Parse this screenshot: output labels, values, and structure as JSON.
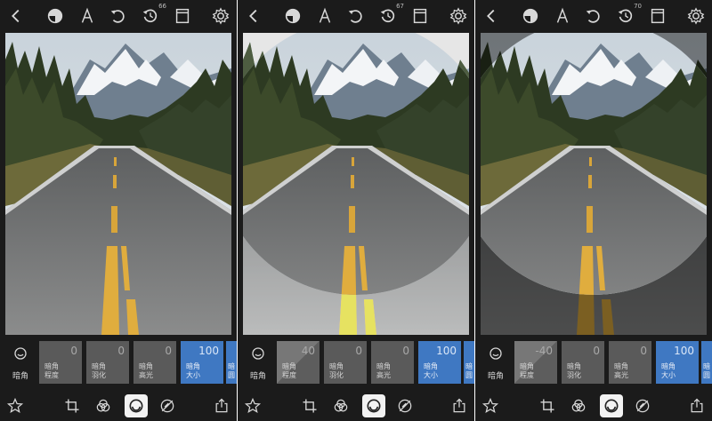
{
  "colors": {
    "panel_bg": "#1b1b1b",
    "tile_gray": "#5a5a5a",
    "tile_blue": "#3f78c2",
    "icon": "#d8d8d8"
  },
  "toolbar_icons": [
    "back-icon",
    "mask-icon",
    "text-icon",
    "undo-icon",
    "history-icon",
    "split-view-icon",
    "settings-icon"
  ],
  "bottom_icons": [
    "star-icon",
    "crop-icon",
    "blend-icon",
    "vignette-tool-icon",
    "heal-icon",
    "share-icon"
  ],
  "panels": [
    {
      "history_count": "66",
      "tool_label": "暗角",
      "tiles": [
        {
          "value": "0",
          "label": "暗角\n程度"
        },
        {
          "value": "0",
          "label": "暗角\n羽化"
        },
        {
          "value": "0",
          "label": "暗角\n高光"
        },
        {
          "value": "100",
          "label": "暗角\n大小"
        },
        {
          "value": "",
          "label": "暗\n圆"
        }
      ]
    },
    {
      "history_count": "67",
      "tool_label": "暗角",
      "tiles": [
        {
          "value": "40",
          "label": "暗角\n程度"
        },
        {
          "value": "0",
          "label": "暗角\n羽化"
        },
        {
          "value": "0",
          "label": "暗角\n高光"
        },
        {
          "value": "100",
          "label": "暗角\n大小"
        },
        {
          "value": "",
          "label": "暗\n圆"
        }
      ]
    },
    {
      "history_count": "70",
      "tool_label": "暗角",
      "tiles": [
        {
          "value": "-40",
          "label": "暗角\n程度"
        },
        {
          "value": "0",
          "label": "暗角\n羽化"
        },
        {
          "value": "0",
          "label": "暗角\n高光"
        },
        {
          "value": "100",
          "label": "暗角\n大小"
        },
        {
          "value": "",
          "label": "暗\n圆"
        }
      ]
    }
  ]
}
